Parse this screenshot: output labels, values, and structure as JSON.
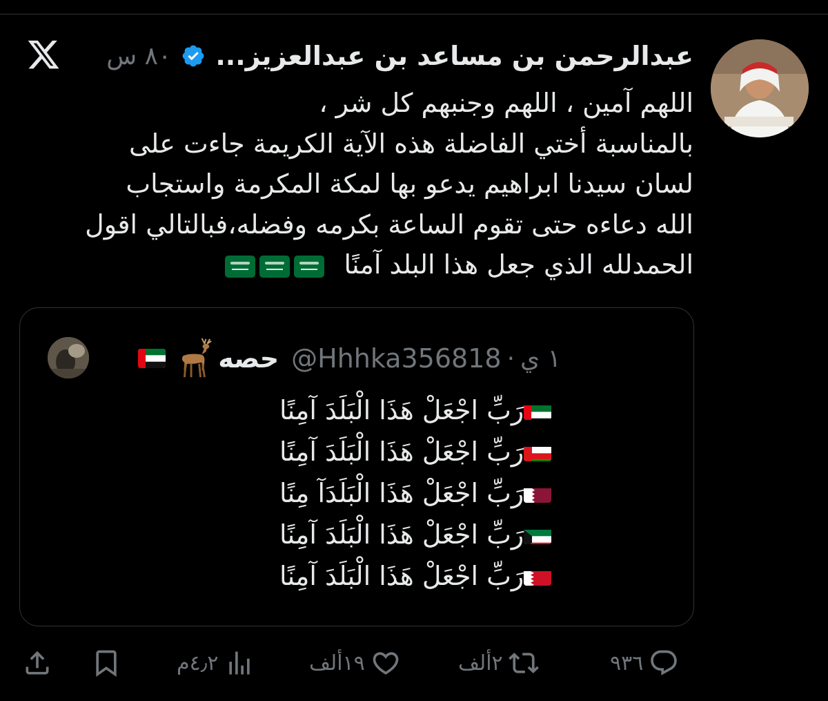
{
  "post": {
    "author_name": "عبدالرحمن بن مساعد بن عبدالعزيز...",
    "time": "٨٠ س",
    "lines": [
      "اللهم آمين ، اللهم وجنبهم كل شر ،",
      "بالمناسبة أختي الفاضلة هذه الآية الكريمة جاءت على",
      "لسان سيدنا ابراهيم يدعو بها لمكة المكرمة واستجاب",
      "الله دعاءه حتى تقوم الساعة بكرمه وفضله،فبالتالي اقول",
      "الحمدلله الذي جعل هذا البلد آمنًا"
    ],
    "end_flag_count": 3
  },
  "quote": {
    "name": "حصه",
    "handle": "@Hhhka356818",
    "time": "١ ي",
    "lines": [
      {
        "text": "رَبِّ اجْعَلْ هَذَا الْبَلَدَ آمِنًا",
        "flag": "uae"
      },
      {
        "text": "رَبِّ اجْعَلْ هَذَا الْبَلَدَ آمِنًا",
        "flag": "oman"
      },
      {
        "text": "رَبِّ اجْعَلْ هَذَا الْبَلَدَآ مِنًا",
        "flag": "qatar"
      },
      {
        "text": "رَبِّ اجْعَلْ هَذَا الْبَلَدَ آمِنًا",
        "flag": "kuwait"
      },
      {
        "text": "رَبِّ اجْعَلْ هَذَا الْبَلَدَ آمِنًا",
        "flag": "bahrain"
      }
    ]
  },
  "actions": {
    "replies": "٩٣٦",
    "reposts": "٢ألف",
    "likes": "١٩ألف",
    "views": "٤٫٢م"
  },
  "colors": {
    "background": "#000000",
    "text": "#e7e9ea",
    "muted": "#71767b",
    "verified": "#1d9bf0",
    "border": "#2f3336"
  },
  "icons": [
    "x-logo-icon",
    "verified-badge-icon",
    "reply-icon",
    "repost-icon",
    "like-icon",
    "views-icon",
    "bookmark-icon",
    "share-icon"
  ]
}
